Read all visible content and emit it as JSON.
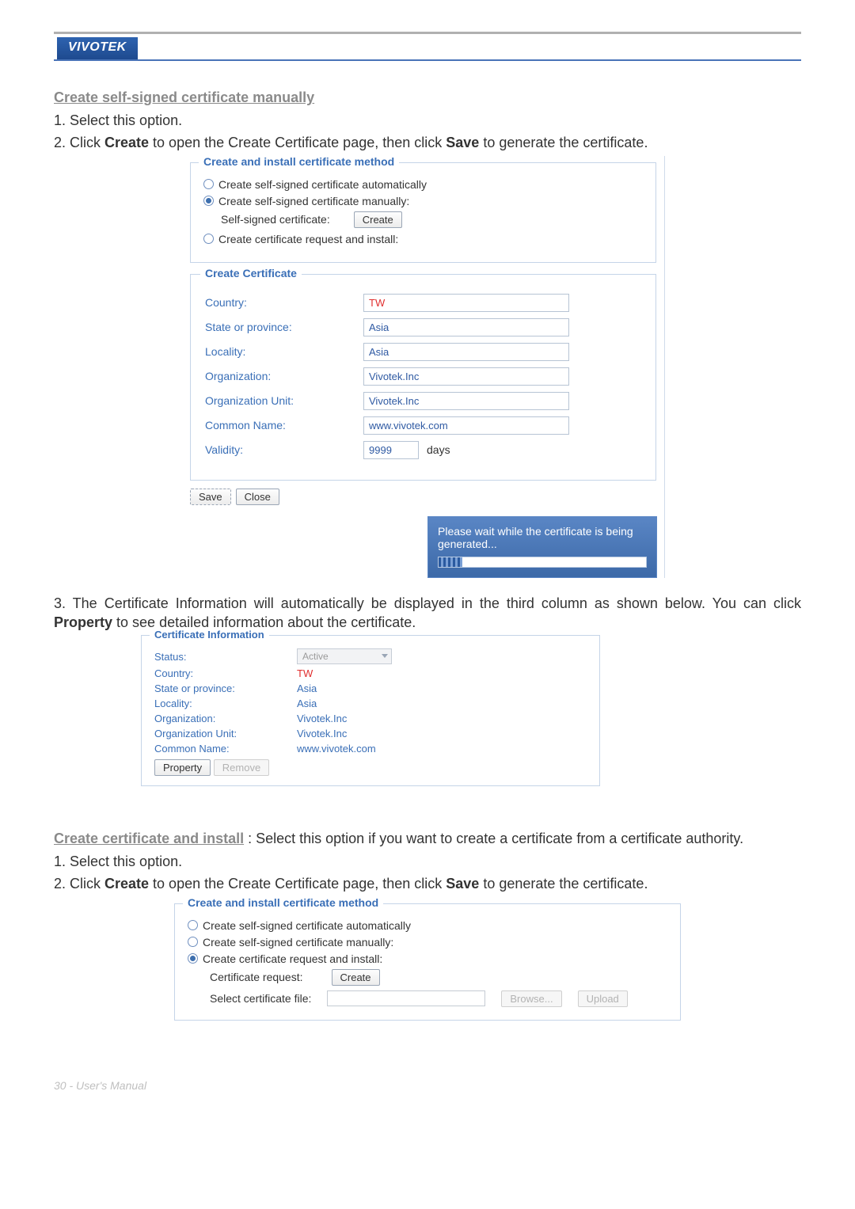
{
  "brand": "VIVOTEK",
  "section1": {
    "heading": "Create self-signed certificate manually",
    "step1": "1. Select this option.",
    "step2_pre": "2. Click ",
    "step2_b1": "Create",
    "step2_mid": " to open the Create Certificate page, then click ",
    "step2_b2": "Save",
    "step2_post": " to generate the certificate."
  },
  "method_fs": {
    "title": "Create and install certificate method",
    "opt_auto": "Create self-signed certificate automatically",
    "opt_manual": "Create self-signed certificate manually:",
    "opt_install": "Create certificate request and install:",
    "self_signed_label": "Self-signed certificate:",
    "create_btn": "Create"
  },
  "create_cert": {
    "title": "Create Certificate",
    "rows": {
      "country": {
        "label": "Country:",
        "value": "TW",
        "red": true
      },
      "state": {
        "label": "State or province:",
        "value": "Asia"
      },
      "locality": {
        "label": "Locality:",
        "value": "Asia"
      },
      "org": {
        "label": "Organization:",
        "value": "Vivotek.Inc"
      },
      "orgunit": {
        "label": "Organization Unit:",
        "value": "Vivotek.Inc"
      },
      "cn": {
        "label": "Common Name:",
        "value": "www.vivotek.com"
      },
      "validity": {
        "label": "Validity:",
        "value": "9999",
        "unit": "days"
      }
    },
    "save": "Save",
    "close": "Close"
  },
  "wait_box": "Please wait while the certificate is being generated...",
  "step3": {
    "pre": "3. The Certificate Information will automatically be displayed in the third column as shown below. You can click ",
    "b": "Property",
    "post": " to see detailed information about the certificate."
  },
  "cert_info": {
    "title": "Certificate Information",
    "status_label": "Status:",
    "status_value": "Active",
    "rows": {
      "country": {
        "label": "Country:",
        "value": "TW",
        "red": true
      },
      "state": {
        "label": "State or province:",
        "value": "Asia"
      },
      "locality": {
        "label": "Locality:",
        "value": "Asia"
      },
      "org": {
        "label": "Organization:",
        "value": "Vivotek.Inc"
      },
      "orgunit": {
        "label": "Organization Unit:",
        "value": "Vivotek.Inc"
      },
      "cn": {
        "label": "Common Name:",
        "value": "www.vivotek.com"
      }
    },
    "property_btn": "Property",
    "remove_btn": "Remove"
  },
  "section2": {
    "heading": "Create certificate and install",
    "desc": " :  Select this option if you want to create a certificate from a certificate authority.",
    "step1": "1. Select this option.",
    "step2_pre": "2. Click ",
    "step2_b1": "Create",
    "step2_mid": " to open the Create Certificate page, then click ",
    "step2_b2": "Save",
    "step2_post": " to generate the certificate."
  },
  "method_fs2": {
    "title": "Create and install certificate method",
    "opt_auto": "Create self-signed certificate automatically",
    "opt_manual": "Create self-signed certificate manually:",
    "opt_install": "Create certificate request and install:",
    "cert_request_label": "Certificate request:",
    "create_btn": "Create",
    "select_file_label": "Select certificate file:",
    "browse_btn": "Browse...",
    "upload_btn": "Upload"
  },
  "footer": "30 - User's Manual"
}
